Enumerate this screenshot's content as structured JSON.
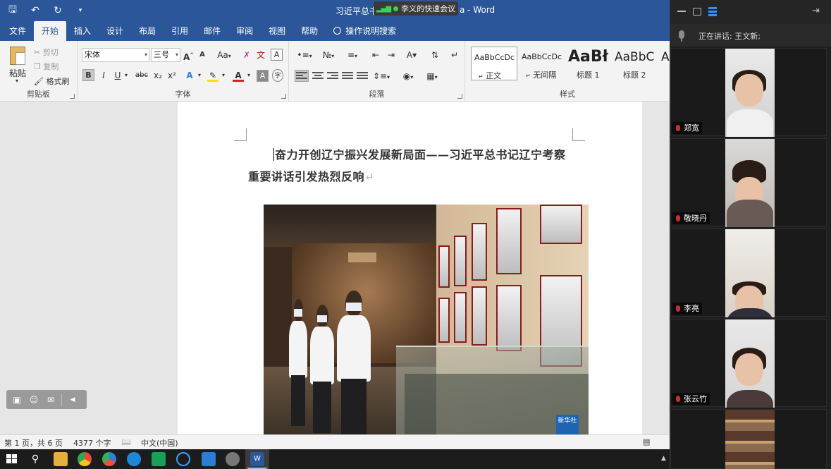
{
  "window": {
    "title": "习近平总书记...a - Word",
    "title_left": "习近平总书",
    "title_right": "a - Word"
  },
  "meeting_pill": {
    "label": "李义的快速会议"
  },
  "tabs": [
    {
      "label": "文件"
    },
    {
      "label": "开始"
    },
    {
      "label": "插入"
    },
    {
      "label": "设计"
    },
    {
      "label": "布局"
    },
    {
      "label": "引用"
    },
    {
      "label": "邮件"
    },
    {
      "label": "审阅"
    },
    {
      "label": "视图"
    },
    {
      "label": "帮助"
    },
    {
      "label": "操作说明搜索"
    }
  ],
  "ribbon": {
    "clipboard": {
      "group": "剪贴板",
      "paste": "粘贴",
      "cut": "剪切",
      "copy": "复制",
      "format_painter": "格式刷"
    },
    "font": {
      "group": "字体",
      "name": "宋体",
      "size": "三号",
      "aa": "Aa",
      "bold": "B",
      "italic": "I",
      "underline": "U",
      "strike": "abc",
      "sub": "x₂",
      "sup": "x²",
      "A": "A",
      "wen": "文",
      "A_box": "A"
    },
    "paragraph": {
      "group": "段落"
    },
    "styles": {
      "group": "样式",
      "items": [
        {
          "preview": "AaBbCcDc",
          "name": "正文"
        },
        {
          "preview": "AaBbCcDc",
          "name": "无间隔"
        },
        {
          "preview": "AaBł",
          "name": "标题 1"
        },
        {
          "preview": "AaBbC",
          "name": "标题 2"
        },
        {
          "preview": "A",
          "name": ""
        }
      ]
    }
  },
  "document": {
    "title_line1": "奋力开创辽宁振兴发展新局面——习近平总书记辽宁",
    "title_line2": "考察重要讲话引发热烈反响",
    "para_mark": "↵",
    "photo_badge": "新华社"
  },
  "statusbar": {
    "page": "第 1 页，共 6 页",
    "words": "4377 个字",
    "lang": "中文(中国)"
  },
  "meeting": {
    "speaking_label": "正在讲话: 王文新;",
    "participants": [
      {
        "name": "郑宽"
      },
      {
        "name": "敬晓丹"
      },
      {
        "name": "李亮"
      },
      {
        "name": "张云竹"
      },
      {
        "name": ""
      }
    ]
  },
  "colors": {
    "word_blue": "#2b579a",
    "meeting_bg": "#1f1f1f",
    "accent_green": "#3ad35a"
  }
}
